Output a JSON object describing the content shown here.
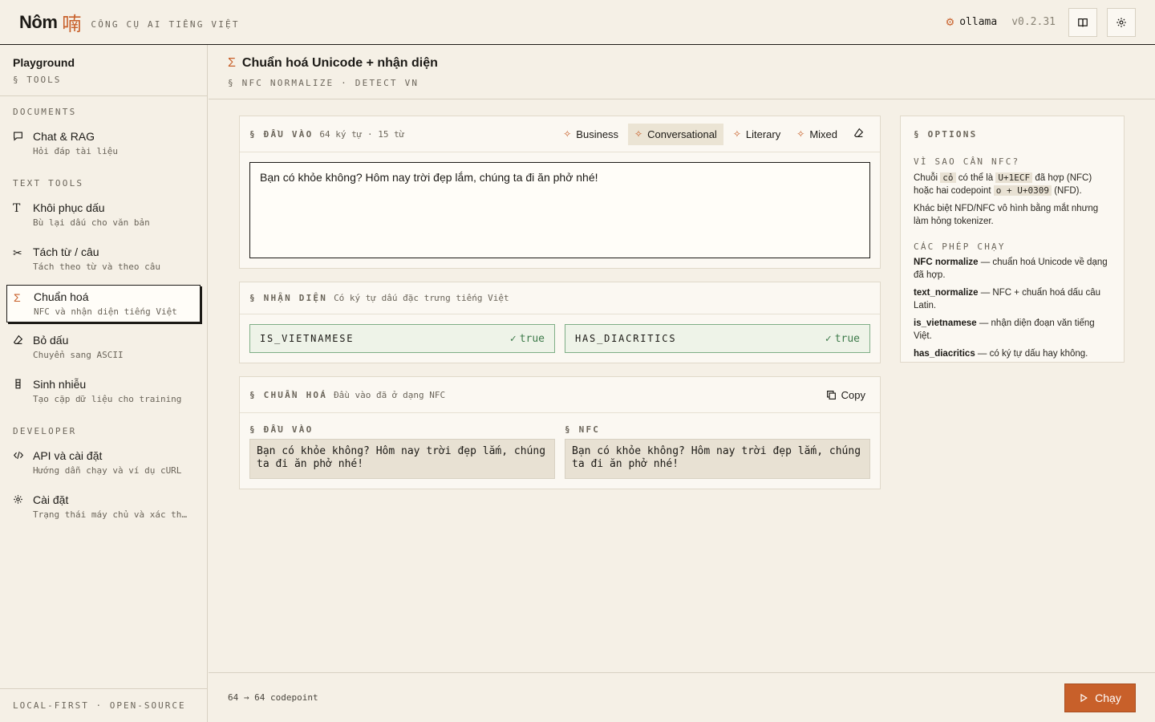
{
  "header": {
    "logo": "Nôm",
    "logo_cjk": "喃",
    "tagline": "CÔNG CỤ AI TIẾNG VIỆT",
    "provider": "ollama",
    "version": "v0.2.31"
  },
  "sidebar": {
    "title": "Playground",
    "subtitle": "§ TOOLS",
    "sections": {
      "documents": "DOCUMENTS",
      "text_tools": "TEXT TOOLS",
      "developer": "DEVELOPER"
    },
    "items": [
      {
        "label": "Chat & RAG",
        "sub": "Hỏi đáp tài liệu"
      },
      {
        "label": "Khôi phục dấu",
        "sub": "Bù lại dấu cho văn bản"
      },
      {
        "label": "Tách từ / câu",
        "sub": "Tách theo từ và theo câu"
      },
      {
        "label": "Chuẩn hoá",
        "sub": "NFC và nhận diện tiếng Việt"
      },
      {
        "label": "Bỏ dấu",
        "sub": "Chuyển sang ASCII"
      },
      {
        "label": "Sinh nhiễu",
        "sub": "Tạo cặp dữ liệu cho training"
      },
      {
        "label": "API và cài đặt",
        "sub": "Hướng dẫn chạy và ví dụ cURL"
      },
      {
        "label": "Cài đặt",
        "sub": "Trạng thái máy chủ và xác thực"
      }
    ],
    "footer": "LOCAL-FIRST · OPEN-SOURCE"
  },
  "page": {
    "title": "Chuẩn hoá Unicode + nhận diện",
    "subtitle": "§ NFC NORMALIZE · DETECT VN"
  },
  "input_card": {
    "label": "§ ĐẦU VÀO",
    "note": "64 ký tự · 15 từ",
    "presets": [
      "Business",
      "Conversational",
      "Literary",
      "Mixed"
    ],
    "active_preset": "Conversational",
    "text": "Bạn có khỏe không? Hôm nay trời đẹp lắm, chúng ta đi ăn phở nhé!"
  },
  "detect_card": {
    "label": "§ NHẬN DIỆN",
    "note": "Có ký tự dấu đặc trưng tiếng Việt",
    "flags": [
      {
        "name": "IS_VIETNAMESE",
        "value": "true"
      },
      {
        "name": "HAS_DIACRITICS",
        "value": "true"
      }
    ]
  },
  "normalize_card": {
    "label": "§ CHUẨN HOÁ",
    "note": "Đầu vào đã ở dạng NFC",
    "copy_label": "Copy",
    "input_label": "§ ĐẦU VÀO",
    "output_label": "§ NFC",
    "input_text": "Bạn có khỏe không? Hôm nay trời đẹp lắm, chúng ta đi ăn phở nhé!",
    "output_text": "Bạn có khỏe không? Hôm nay trời đẹp lắm, chúng ta đi ăn phở nhé!"
  },
  "options": {
    "title": "§ OPTIONS",
    "why_title": "VÌ SAO CẦN NFC?",
    "why_p1_a": "Chuỗi",
    "why_chip1": "cỏ",
    "why_p1_b": "có thể là",
    "why_chip2": "U+1ECF",
    "why_p1_c": "đã hợp (NFC) hoặc hai codepoint",
    "why_chip3": "o + U+0309",
    "why_p1_d": "(NFD).",
    "why_p2": "Khác biệt NFD/NFC vô hình bằng mắt nhưng làm hỏng tokenizer.",
    "ops_title": "CÁC PHÉP CHẠY",
    "ops": [
      {
        "name": "NFC normalize",
        "desc": " — chuẩn hoá Unicode về dạng đã hợp."
      },
      {
        "name": "text_normalize",
        "desc": " — NFC + chuẩn hoá dấu câu Latin."
      },
      {
        "name": "is_vietnamese",
        "desc": " — nhận diện đoạn văn tiếng Việt."
      },
      {
        "name": "has_diacritics",
        "desc": " — có ký tự dấu hay không."
      }
    ]
  },
  "footer": {
    "count": "64 → 64 codepoint",
    "run_label": "Chạy"
  },
  "colors": {
    "accent": "#c8602a",
    "background": "#f5f0e6",
    "success": "#3d7a4a"
  }
}
